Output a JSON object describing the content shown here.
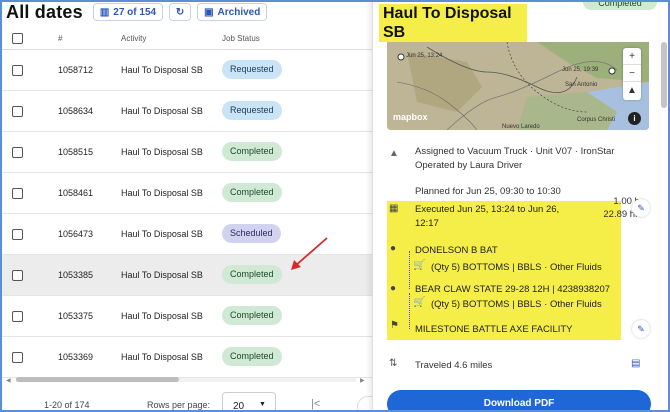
{
  "header": {
    "title": "All dates",
    "count_chip": "27 of 154",
    "archived_chip": "Archived"
  },
  "table": {
    "columns": [
      "#",
      "Activity",
      "Job Status"
    ],
    "rows": [
      {
        "id": "1058712",
        "activity": "Haul To Disposal SB",
        "status": "Requested"
      },
      {
        "id": "1058634",
        "activity": "Haul To Disposal SB",
        "status": "Requested"
      },
      {
        "id": "1058515",
        "activity": "Haul To Disposal SB",
        "status": "Completed"
      },
      {
        "id": "1058461",
        "activity": "Haul To Disposal SB",
        "status": "Completed"
      },
      {
        "id": "1056473",
        "activity": "Haul To Disposal SB",
        "status": "Scheduled"
      },
      {
        "id": "1053385",
        "activity": "Haul To Disposal SB",
        "status": "Completed"
      },
      {
        "id": "1053375",
        "activity": "Haul To Disposal SB",
        "status": "Completed"
      },
      {
        "id": "1053369",
        "activity": "Haul To Disposal SB",
        "status": "Completed"
      }
    ]
  },
  "pager": {
    "range": "1-20 of 174",
    "rows_per_page_label": "Rows per page:",
    "rows_per_page": "20"
  },
  "detail": {
    "title_line1": "Haul To Disposal",
    "title_line2": "SB",
    "status": "Completed",
    "map": {
      "logo": "mapbox",
      "labels": [
        "Jun 25, 13:24",
        "Jun 25, 19:39",
        "San Antonio",
        "Corpus Christi",
        "Nuevo Laredo"
      ]
    },
    "assigned": "Assigned to Vacuum Truck · Unit V07 · IronStar",
    "operated": "Operated by Laura Driver",
    "planned": "Planned for Jun 25, 09:30 to 10:30",
    "planned_duration": "1.00 hr",
    "executed_line1": "Executed Jun 25, 13:24 to Jun 26,",
    "executed_line2": "12:17",
    "executed_duration": "22.89 hrs",
    "stops": [
      {
        "name": "DONELSON B BAT",
        "detail": "(Qty 5) BOTTOMS | BBLS · Other Fluids"
      },
      {
        "name": "BEAR CLAW STATE 29-28 12H | 4238938207",
        "detail": "(Qty 5) BOTTOMS | BBLS · Other Fluids"
      }
    ],
    "destination": "MILESTONE BATTLE AXE FACILITY",
    "traveled": "Traveled 4.6 miles",
    "pdf_button": "Download PDF"
  },
  "colors": {
    "requested": "#c9e3f7",
    "completed": "#cfe9d4",
    "scheduled": "#d2d2ef",
    "highlight": "#f6ee48",
    "primary": "#1f66d6"
  }
}
